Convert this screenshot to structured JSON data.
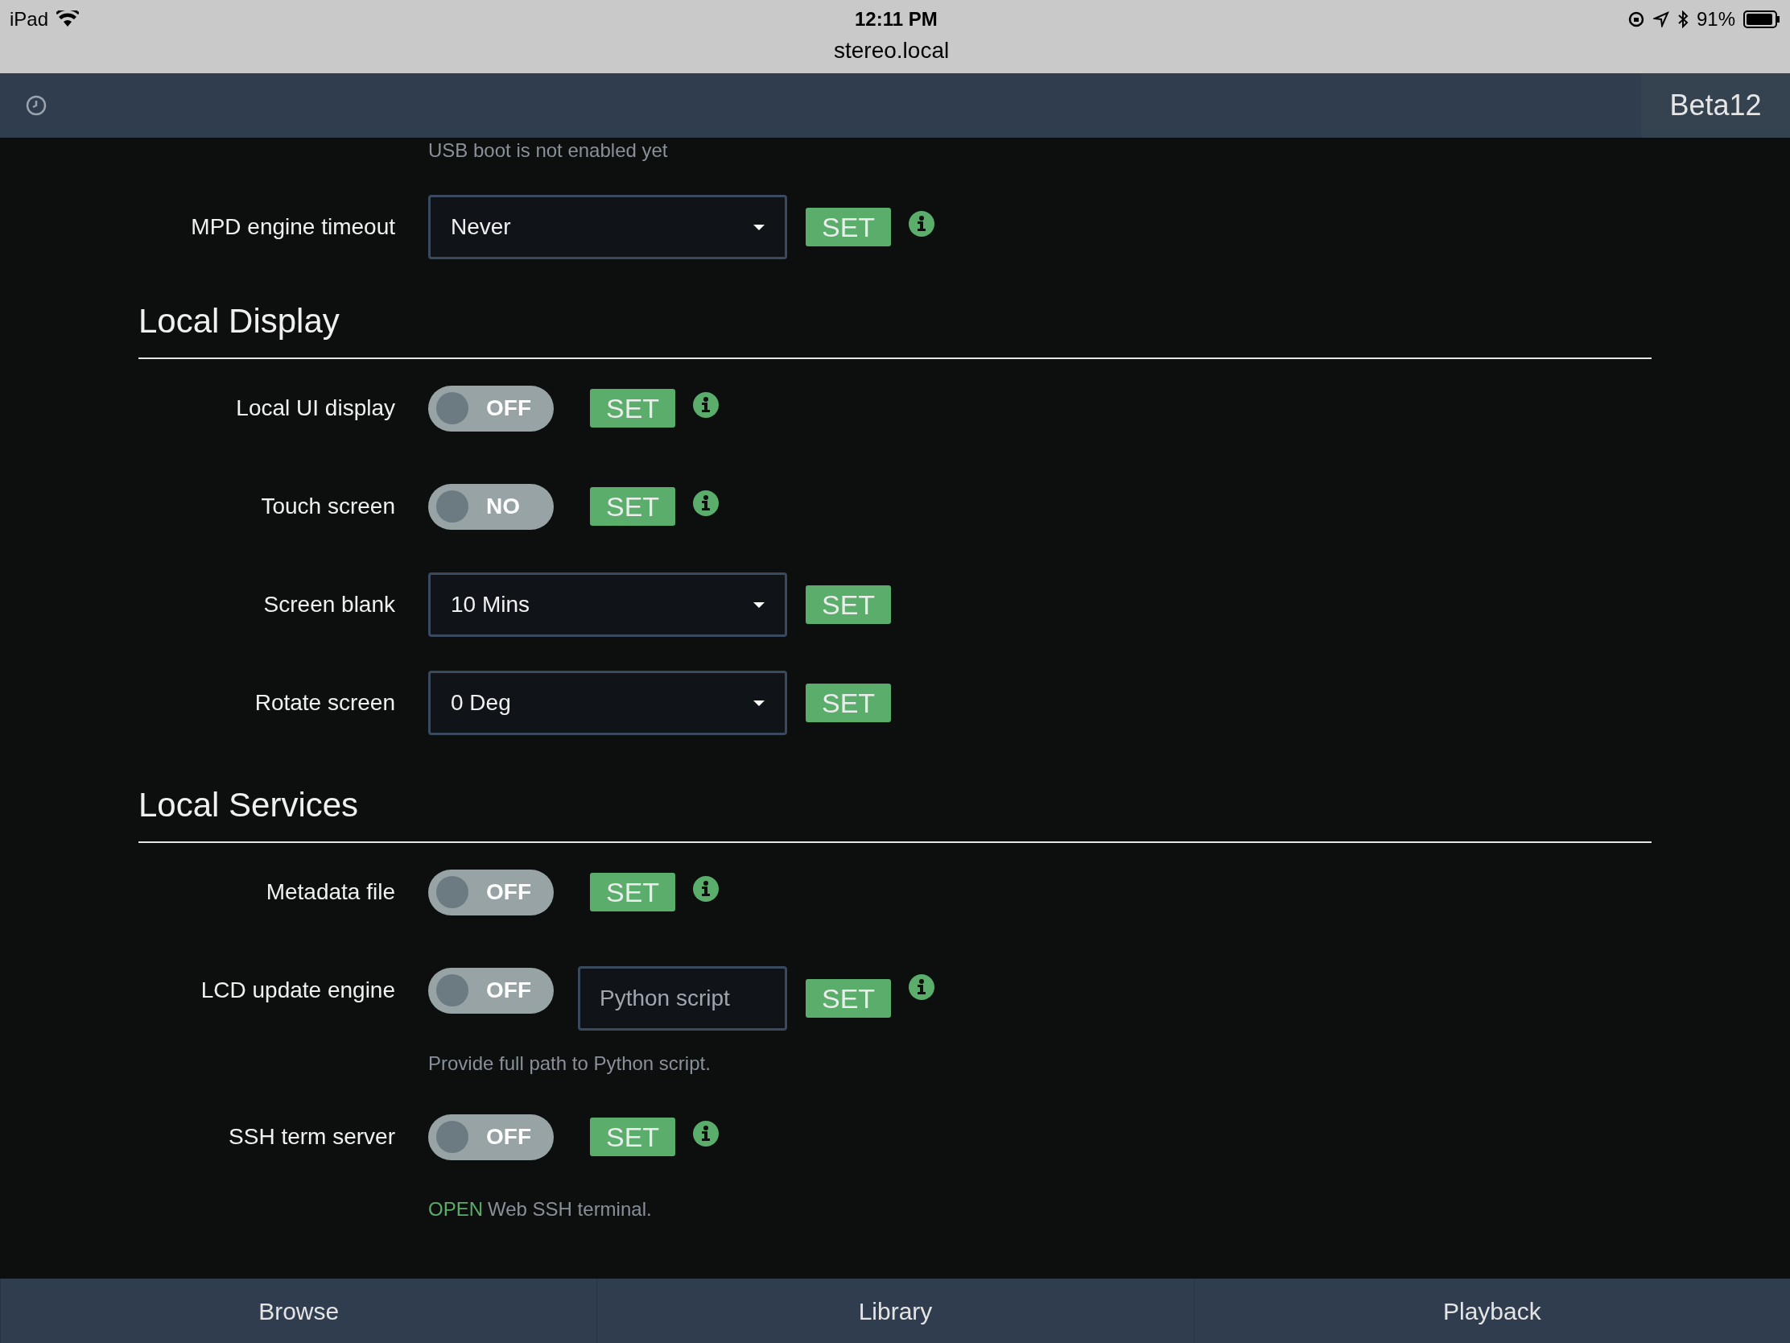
{
  "status_bar": {
    "device": "iPad",
    "time": "12:11 PM",
    "url": "stereo.local",
    "battery": "91%"
  },
  "header": {
    "version": "Beta12"
  },
  "content": [
    {
      "kind": "note",
      "text": "USB boot is not enabled yet"
    },
    {
      "kind": "select",
      "label": "MPD engine timeout",
      "value": "Never",
      "button": "SET",
      "info": true
    },
    {
      "kind": "heading",
      "text": "Local Display"
    },
    {
      "kind": "toggle",
      "label": "Local UI display",
      "toggle": {
        "text": "OFF",
        "on": false
      },
      "button": "SET",
      "info": true
    },
    {
      "kind": "toggle",
      "label": "Touch screen",
      "toggle": {
        "text": "NO",
        "on": false
      },
      "button": "SET",
      "info": true
    },
    {
      "kind": "select",
      "label": "Screen blank",
      "value": "10 Mins",
      "button": "SET",
      "info": false
    },
    {
      "kind": "select",
      "label": "Rotate screen",
      "value": "0 Deg",
      "button": "SET",
      "info": false
    },
    {
      "kind": "heading",
      "text": "Local Services"
    },
    {
      "kind": "toggle",
      "label": "Metadata file",
      "toggle": {
        "text": "OFF",
        "on": false
      },
      "button": "SET",
      "info": true
    },
    {
      "kind": "toggle_input",
      "label": "LCD update engine",
      "toggle": {
        "text": "OFF",
        "on": false
      },
      "placeholder": "Python script",
      "button": "SET",
      "info": true
    },
    {
      "kind": "help",
      "text": "Provide full path to Python script."
    },
    {
      "kind": "toggle",
      "label": "SSH term server",
      "toggle": {
        "text": "OFF",
        "on": false
      },
      "button": "SET",
      "info": true
    },
    {
      "kind": "link_note",
      "link": "OPEN",
      "text": "Web SSH terminal."
    }
  ],
  "tabs": [
    {
      "label": "Browse"
    },
    {
      "label": "Library"
    },
    {
      "label": "Playback"
    }
  ]
}
